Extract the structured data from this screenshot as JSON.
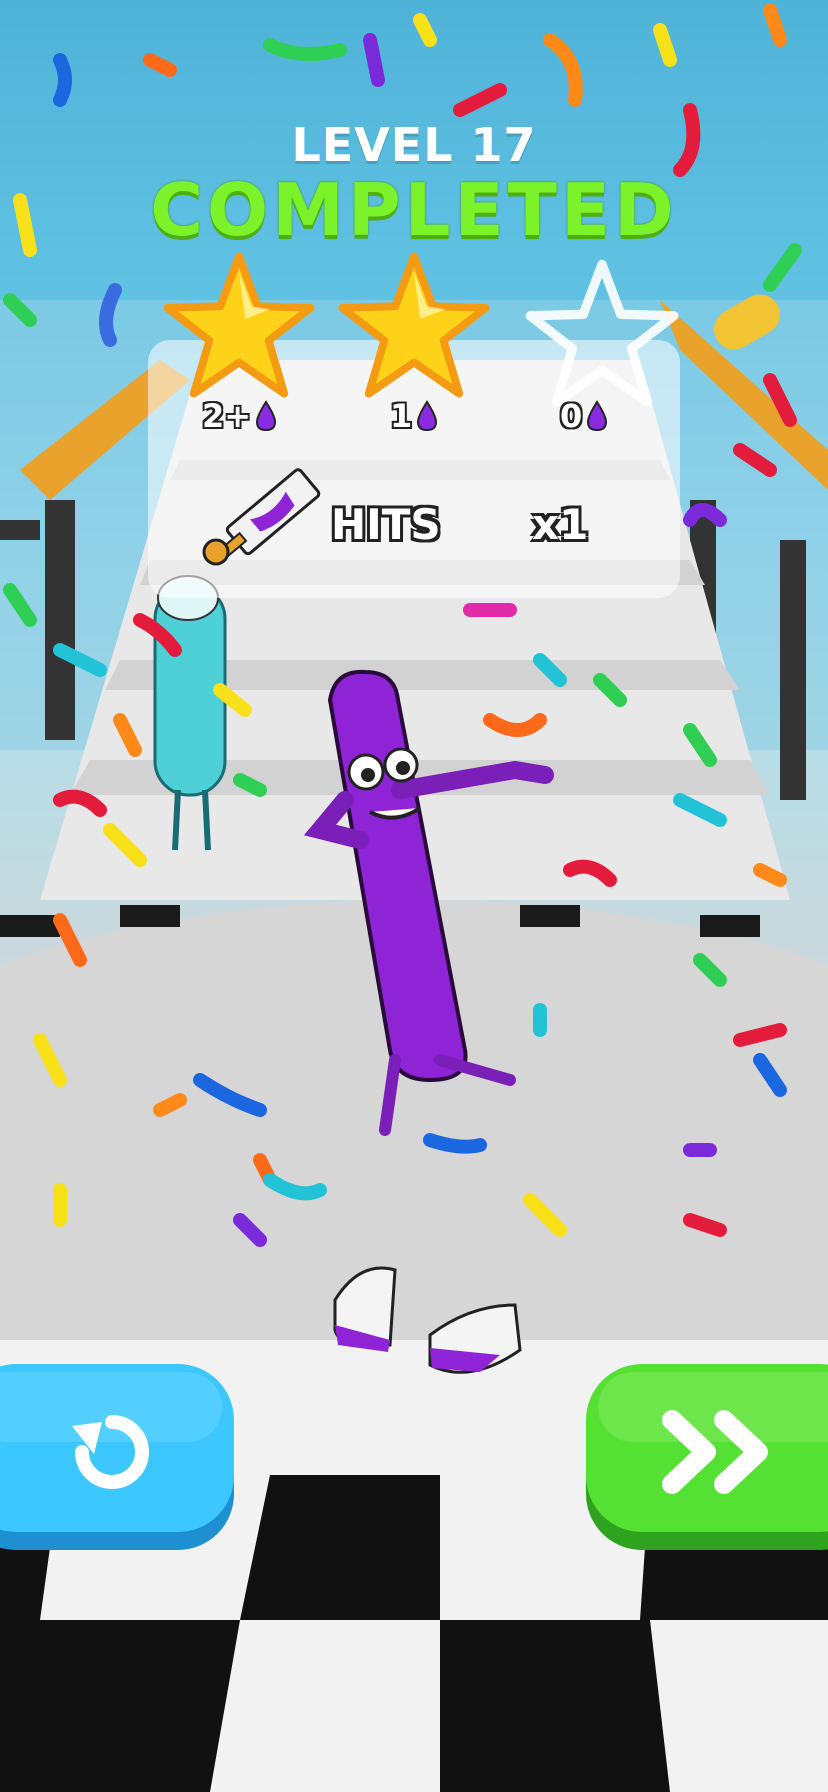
{
  "hud": {
    "level_label": "LEVEL 17",
    "status_label": "COMPLETED"
  },
  "stars": {
    "earned": 2,
    "total": 3
  },
  "rewards": [
    {
      "value": "2+",
      "icon": "purple-drop-icon"
    },
    {
      "value": "1",
      "icon": "purple-drop-icon"
    },
    {
      "value": "0",
      "icon": "purple-drop-icon"
    }
  ],
  "hits": {
    "icon": "paint-roller-icon",
    "label": "HITS",
    "multiplier": "x1"
  },
  "buttons": {
    "retry_icon": "restart-icon",
    "next_icon": "fast-forward-icon"
  },
  "colors": {
    "completed": "#7cf22a",
    "star_filled": "#ffd21a",
    "star_outline": "#f59b12",
    "retry_button": "#3cc8ff",
    "next_button": "#55e034",
    "drop": "#8a2be2",
    "character": "#8e24d6"
  }
}
